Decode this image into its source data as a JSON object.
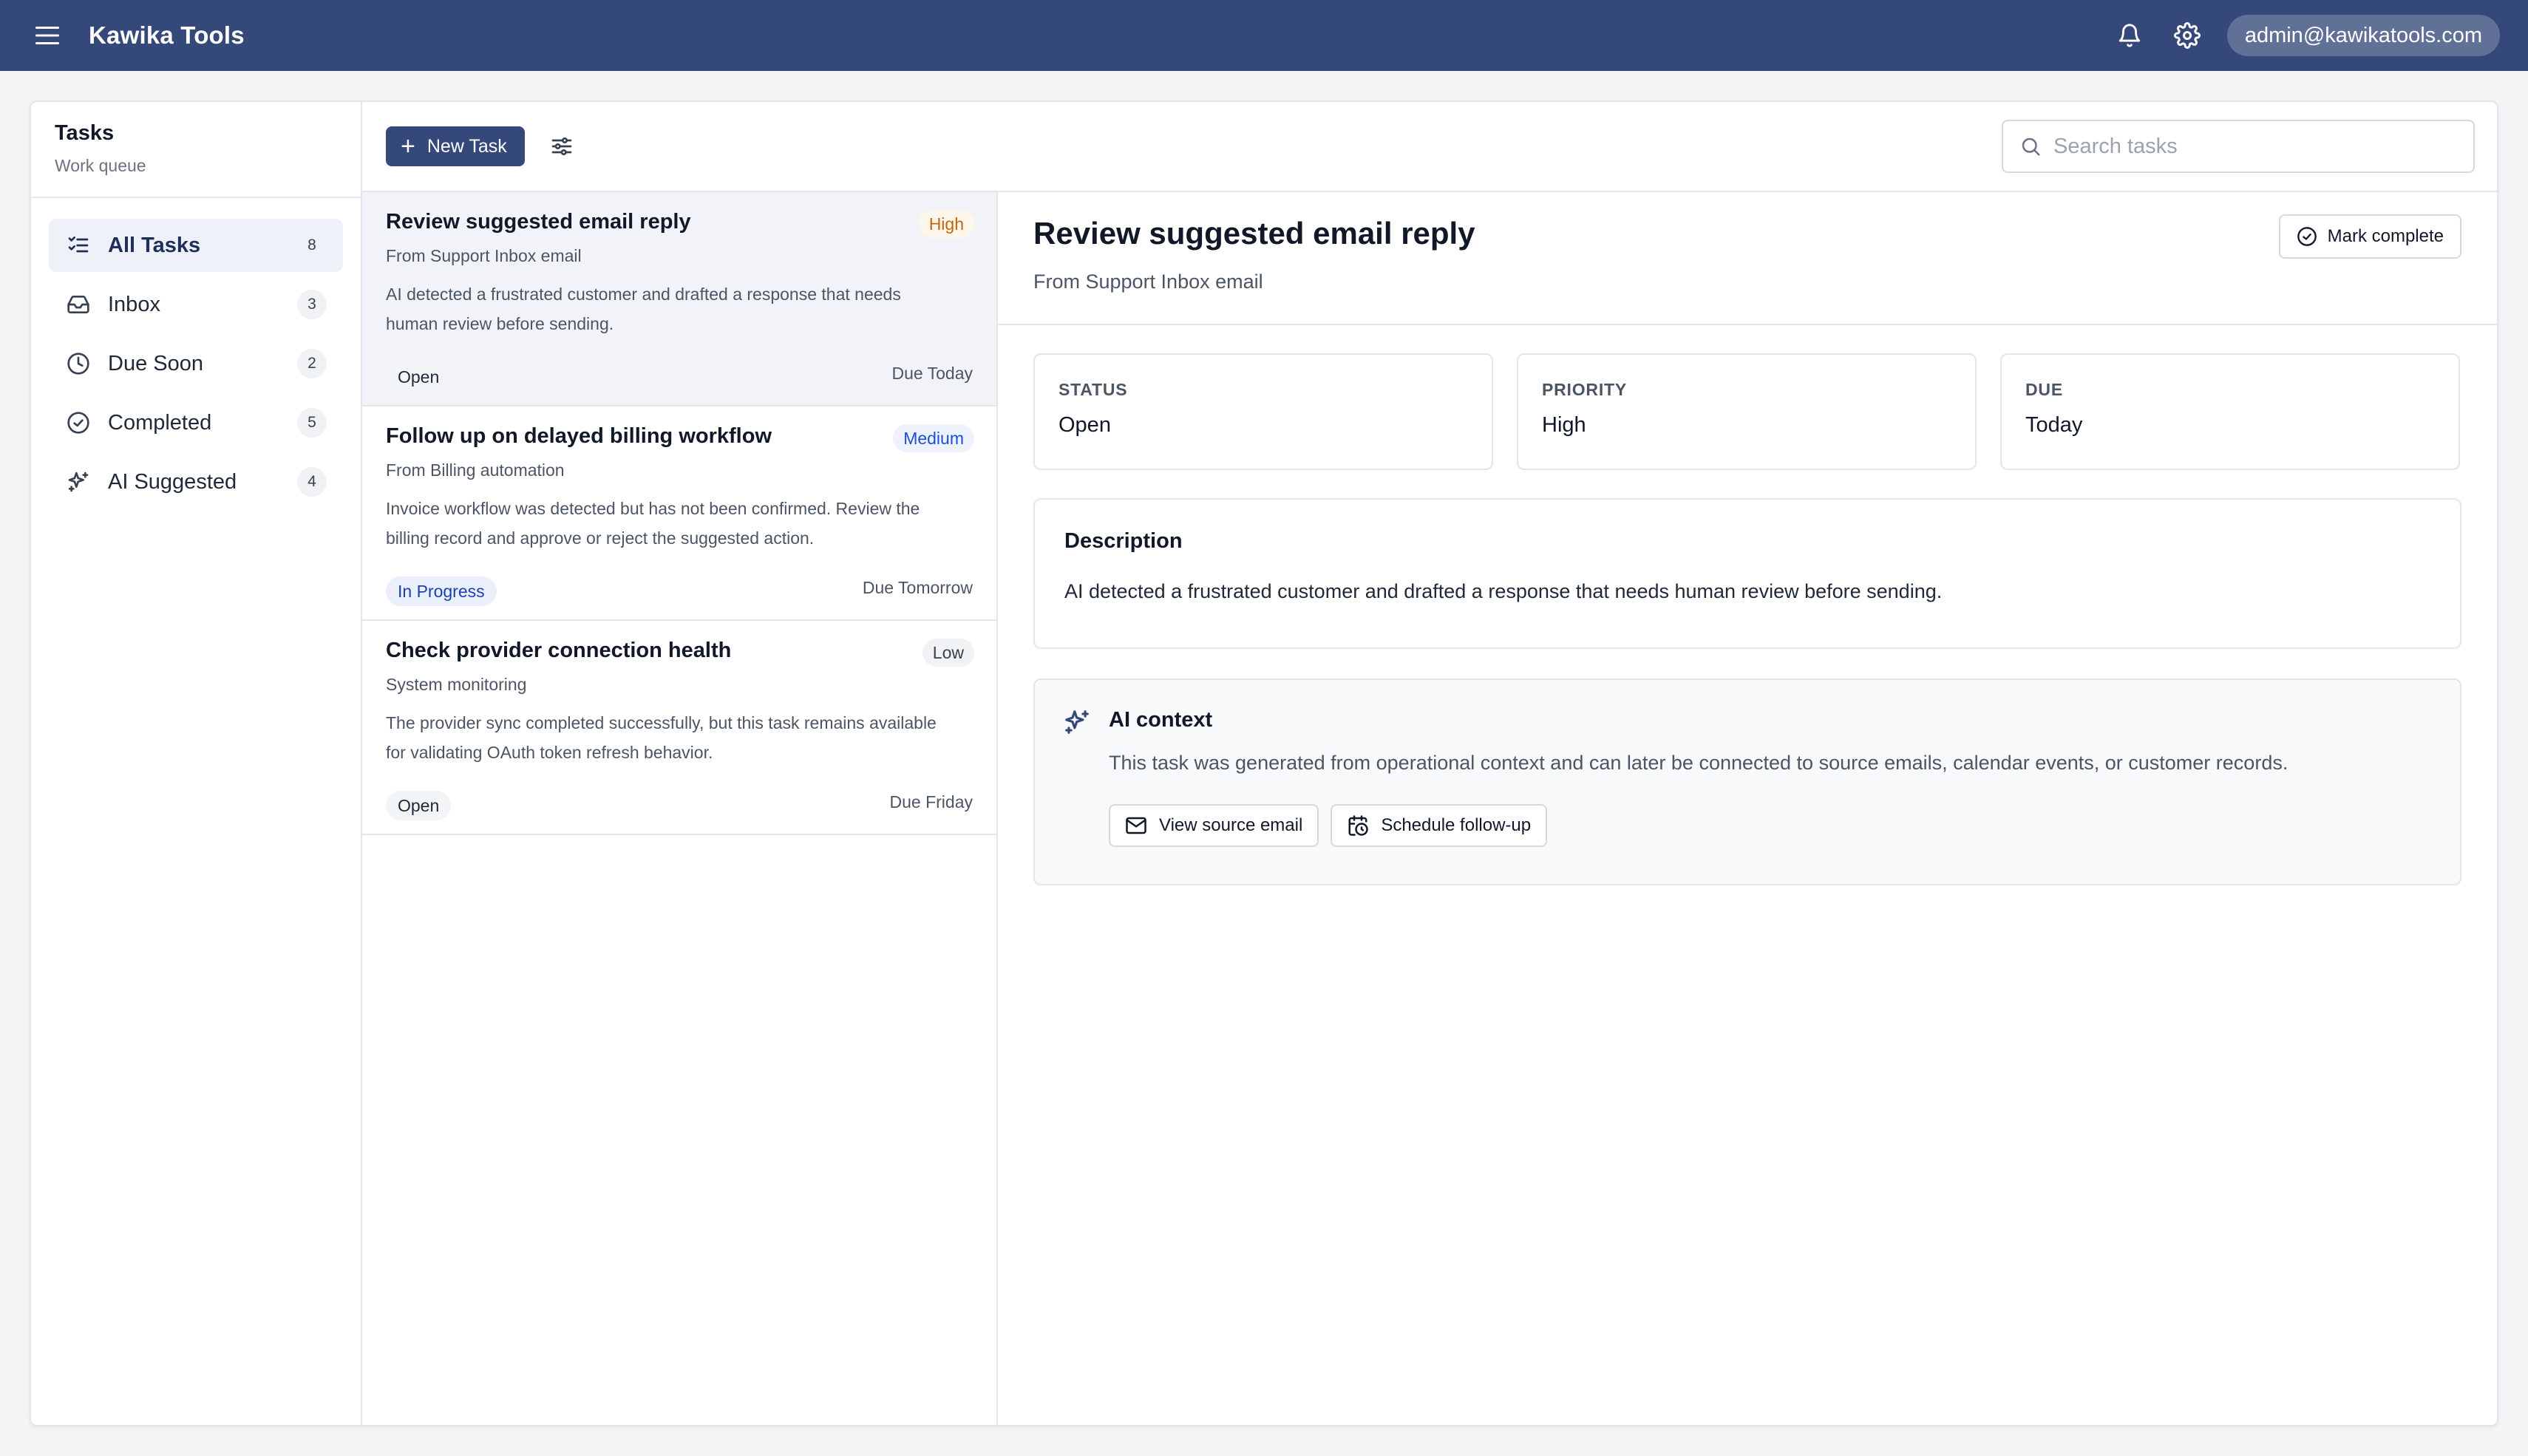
{
  "app": {
    "title": "Kawika Tools",
    "user_email": "admin@kawikatools.com",
    "brand_color": "#34487a"
  },
  "icons": {
    "menu": "menu-icon",
    "notifications": "bell-icon",
    "settings": "gear-icon"
  },
  "sidebar": {
    "title": "Tasks",
    "subtitle": "Work queue",
    "items": [
      {
        "label": "All Tasks",
        "count": "8",
        "icon": "list-check-icon",
        "active": true
      },
      {
        "label": "Inbox",
        "count": "3",
        "icon": "inbox-icon"
      },
      {
        "label": "Due Soon",
        "count": "2",
        "icon": "clock-icon"
      },
      {
        "label": "Completed",
        "count": "5",
        "icon": "check-circle-icon"
      },
      {
        "label": "AI Suggested",
        "count": "4",
        "icon": "sparkles-icon"
      }
    ]
  },
  "toolbar": {
    "new_task_label": "New Task",
    "search_placeholder": "Search tasks"
  },
  "tasks": [
    {
      "title": "Review suggested email reply",
      "source": "From Support Inbox email",
      "description": "AI detected a frustrated customer and drafted a response that needs human review before sending.",
      "priority": "High",
      "status": "Open",
      "due": "Due Today",
      "selected": true
    },
    {
      "title": "Follow up on delayed billing workflow",
      "source": "From Billing automation",
      "description": "Invoice workflow was detected but has not been confirmed. Review the billing record and approve or reject the suggested action.",
      "priority": "Medium",
      "status": "In Progress",
      "due": "Due Tomorrow"
    },
    {
      "title": "Check provider connection health",
      "source": "System monitoring",
      "description": "The provider sync completed successfully, but this task remains available for validating OAuth token refresh behavior.",
      "priority": "Low",
      "status": "Open",
      "due": "Due Friday"
    }
  ],
  "detail": {
    "title": "Review suggested email reply",
    "source": "From Support Inbox email",
    "mark_complete_label": "Mark complete",
    "meta": [
      {
        "label": "STATUS",
        "value": "Open"
      },
      {
        "label": "PRIORITY",
        "value": "High"
      },
      {
        "label": "DUE",
        "value": "Today"
      }
    ],
    "description_label": "Description",
    "description": "AI detected a frustrated customer and drafted a response that needs human review before sending.",
    "ai": {
      "title": "AI context",
      "text": "This task was generated from operational context and can later be connected to source emails, calendar events, or customer records.",
      "view_source_label": "View source email",
      "schedule_label": "Schedule follow-up"
    }
  }
}
